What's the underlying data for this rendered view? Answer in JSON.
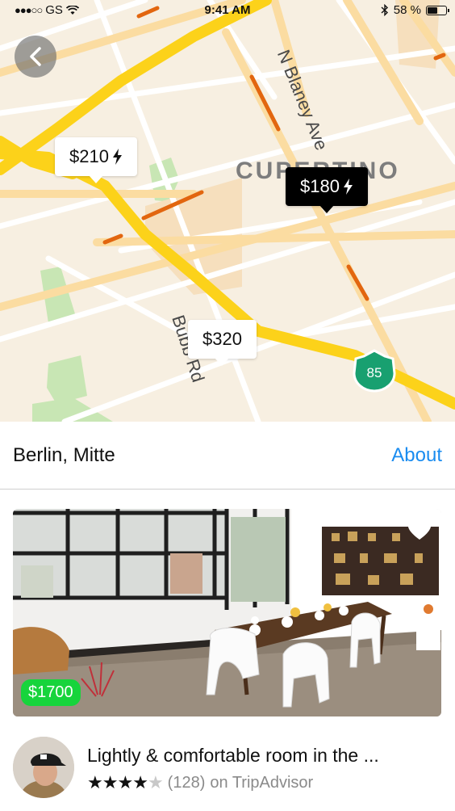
{
  "status_bar": {
    "carrier": "GS",
    "signal_dots": "●●●○○",
    "wifi_icon": "wifi-icon",
    "time": "9:41 AM",
    "bluetooth_icon": "bluetooth-icon",
    "battery_percent": "58 %",
    "battery_level": 0.58
  },
  "map": {
    "back_icon": "chevron-left-icon",
    "street_labels": {
      "blaney": "N Blaney Ave",
      "bubb": "Bubb Rd"
    },
    "area_label": "CUPERTINO",
    "highway_shield": "85",
    "pins": [
      {
        "price": "$210",
        "instant_book": true,
        "active": false
      },
      {
        "price": "$180",
        "instant_book": true,
        "active": true
      },
      {
        "price": "$320",
        "instant_book": false,
        "active": false
      }
    ]
  },
  "location": {
    "name": "Berlin, Mitte",
    "about_label": "About"
  },
  "listing": {
    "price": "$1700",
    "favorite_icon": "heart-icon",
    "title": "Lightly & comfortable room in the ...",
    "rating_stars": 4,
    "rating_max": 5,
    "review_count": "(128)",
    "review_source": "on TripAdvisor"
  },
  "colors": {
    "accent_blue": "#1a8cf0",
    "price_green": "#17d43c",
    "highway_yellow": "#fcd21a",
    "map_background": "#f7efe1",
    "shield_green": "#18a070"
  }
}
